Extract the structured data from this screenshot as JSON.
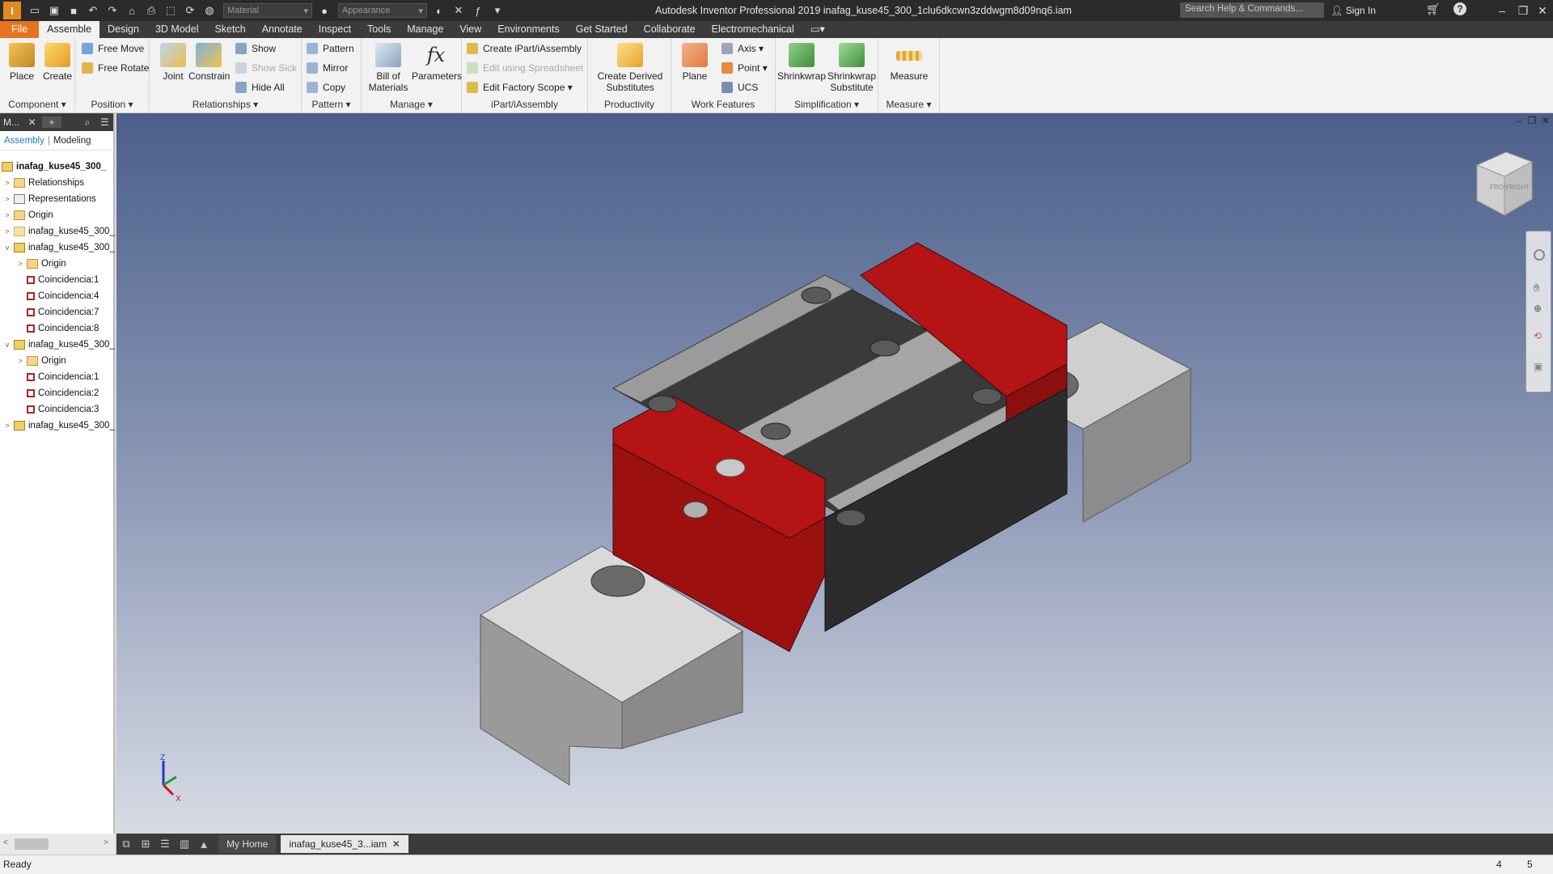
{
  "titlebar": {
    "logo_text": "I",
    "material_combo": "Material",
    "appearance_combo": "Appearance",
    "title": "Autodesk Inventor Professional 2019   inafag_kuse45_300_1clu6dkcwn3zddwgm8d09nq6.iam",
    "search_placeholder": "Search Help & Commands...",
    "sign_in": "Sign In",
    "help": "?"
  },
  "menu": {
    "tabs": [
      "File",
      "Assemble",
      "Design",
      "3D Model",
      "Sketch",
      "Annotate",
      "Inspect",
      "Tools",
      "Manage",
      "View",
      "Environments",
      "Get Started",
      "Collaborate",
      "Electromechanical"
    ],
    "active": "Assemble"
  },
  "ribbon": {
    "component": {
      "title": "Component",
      "place": "Place",
      "create": "Create"
    },
    "position": {
      "title": "Position",
      "free_move": "Free Move",
      "free_rotate": "Free Rotate"
    },
    "relationships": {
      "title": "Relationships",
      "joint": "Joint",
      "constrain": "Constrain",
      "show": "Show",
      "show_sick": "Show Sick",
      "hide_all": "Hide All"
    },
    "pattern": {
      "title": "Pattern",
      "pattern": "Pattern",
      "mirror": "Mirror",
      "copy": "Copy"
    },
    "manage": {
      "title": "Manage",
      "bill_line1": "Bill of",
      "bill_line2": "Materials",
      "parameters": "Parameters"
    },
    "ipart": {
      "title": "iPart/iAssembly",
      "create": "Create iPart/iAssembly",
      "edit_spreadsheet": "Edit using Spreadsheet",
      "edit_factory": "Edit Factory Scope"
    },
    "productivity": {
      "title": "Productivity",
      "line1": "Create Derived",
      "line2": "Substitutes"
    },
    "work_features": {
      "title": "Work Features",
      "plane": "Plane",
      "axis": "Axis",
      "point": "Point",
      "ucs": "UCS"
    },
    "simplification": {
      "title": "Simplification",
      "shrinkwrap": "Shrinkwrap",
      "sub_line1": "Shrinkwrap",
      "sub_line2": "Substitute"
    },
    "measure": {
      "title": "Measure",
      "measure": "Measure"
    }
  },
  "browser": {
    "title": "M...",
    "tab_assembly": "Assembly",
    "tab_modeling": "Modeling",
    "root": "inafag_kuse45_300_",
    "rows": [
      {
        "label": "Relationships",
        "icon": "folder-icon"
      },
      {
        "label": "Representations",
        "icon": "representations-icon"
      },
      {
        "label": "Origin",
        "icon": "folder-icon"
      },
      {
        "label": "inafag_kuse45_300_",
        "icon": "part-icon"
      },
      {
        "label": "inafag_kuse45_300_",
        "icon": "part-icon"
      },
      {
        "label": "Origin",
        "icon": "folder-icon"
      },
      {
        "label": "Coincidencia:1",
        "icon": "constraint-icon"
      },
      {
        "label": "Coincidencia:4",
        "icon": "constraint-icon"
      },
      {
        "label": "Coincidencia:7",
        "icon": "constraint-icon"
      },
      {
        "label": "Coincidencia:8",
        "icon": "constraint-icon"
      },
      {
        "label": "inafag_kuse45_300_",
        "icon": "part-icon"
      },
      {
        "label": "Origin",
        "icon": "folder-icon"
      },
      {
        "label": "Coincidencia:1",
        "icon": "constraint-icon"
      },
      {
        "label": "Coincidencia:2",
        "icon": "constraint-icon"
      },
      {
        "label": "Coincidencia:3",
        "icon": "constraint-icon"
      },
      {
        "label": "inafag_kuse45_300_",
        "icon": "part-icon"
      }
    ]
  },
  "viewport": {
    "viewcube_front": "FRONT",
    "viewcube_right": "RIGHT",
    "triad_z": "Z",
    "triad_x": "X"
  },
  "doctabs": {
    "home": "My Home",
    "active_doc": "inafag_kuse45_3...iam"
  },
  "status": {
    "text": "Ready",
    "num1": "4",
    "num2": "5"
  },
  "colors": {
    "file_tab": "#e6731f",
    "carriage_red": "#b51414",
    "rail_grey": "#a9a9a9"
  }
}
